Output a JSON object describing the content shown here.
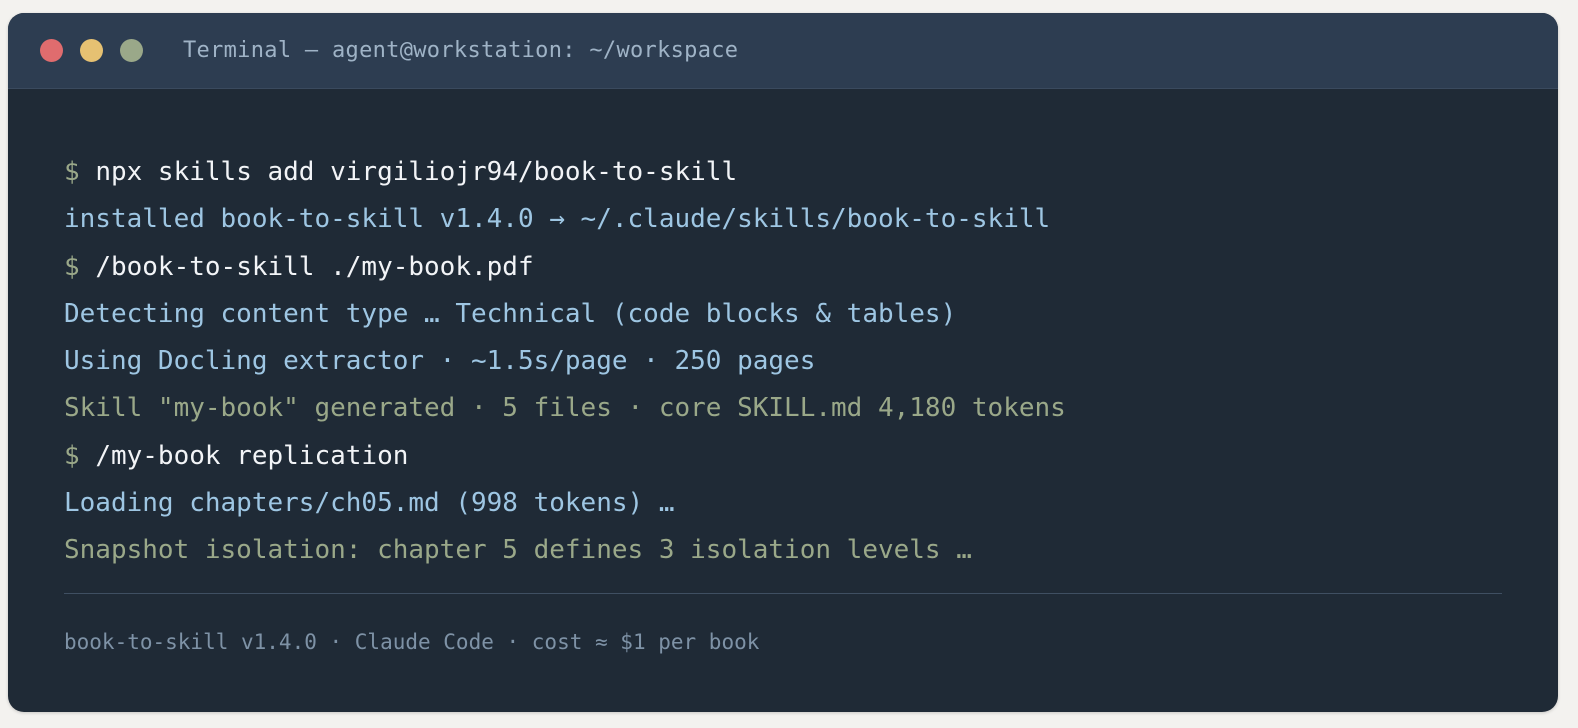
{
  "window": {
    "title": "Terminal — agent@workstation: ~/workspace",
    "controls": {
      "close_color": "#e06c6e",
      "minimize_color": "#e6c172",
      "maximize_color": "#9aa889"
    }
  },
  "terminal": {
    "prompt_symbol": "$",
    "lines": [
      {
        "kind": "command",
        "prompt": "$",
        "text": "npx skills add virgiliojr94/book-to-skill"
      },
      {
        "kind": "output",
        "text": "installed book-to-skill v1.4.0 → ~/.claude/skills/book-to-skill"
      },
      {
        "kind": "command",
        "prompt": "$",
        "text": "/book-to-skill ./my-book.pdf"
      },
      {
        "kind": "output",
        "text": "Detecting content type … Technical (code blocks & tables)"
      },
      {
        "kind": "output",
        "text": "Using Docling extractor · ~1.5s/page · 250 pages"
      },
      {
        "kind": "success",
        "text": "Skill \"my-book\" generated · 5 files · core SKILL.md 4,180 tokens"
      },
      {
        "kind": "command",
        "prompt": "$",
        "text": "/my-book replication"
      },
      {
        "kind": "output",
        "text": "Loading chapters/ch05.md (998 tokens) …"
      },
      {
        "kind": "success",
        "text": "Snapshot isolation: chapter 5 defines 3 isolation levels …"
      }
    ]
  },
  "footer": {
    "text": "book-to-skill v1.4.0 · Claude Code · cost ≈ $1 per book"
  },
  "colors": {
    "background": "#1f2a36",
    "titlebar": "#2d3d51",
    "prompt": "#9aa889",
    "command": "#f2f4f7",
    "output": "#9ec6e3",
    "success": "#9aa889",
    "footer": "#7e92a6"
  }
}
